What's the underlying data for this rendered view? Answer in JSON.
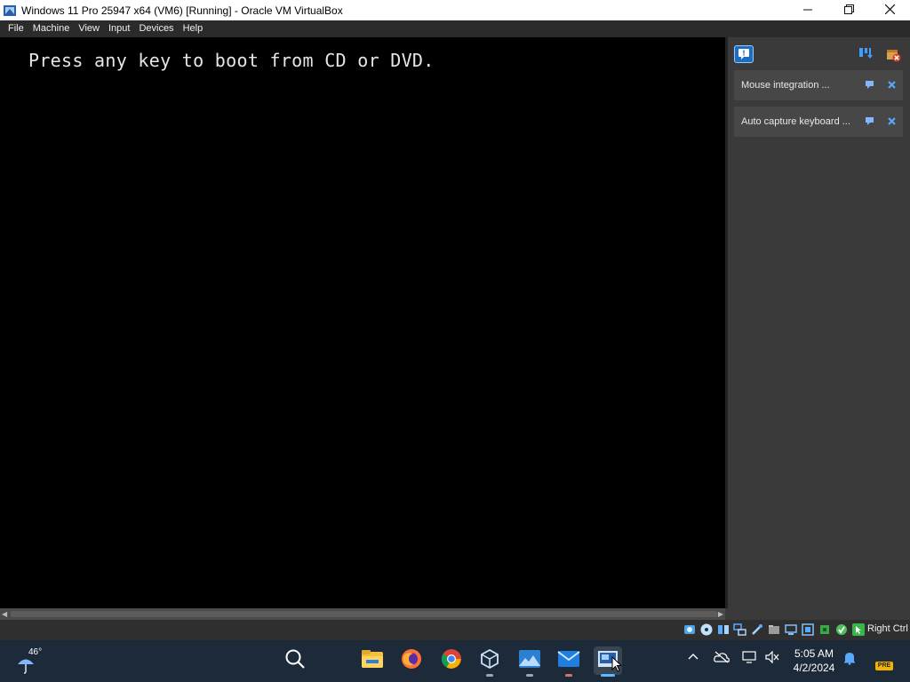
{
  "window": {
    "title": "Windows 11 Pro 25947 x64 (VM6) [Running] - Oracle VM VirtualBox",
    "minimize_icon": "minimize-icon",
    "maximize_icon": "restore-icon",
    "close_icon": "close-icon"
  },
  "menu": {
    "items": [
      "File",
      "Machine",
      "View",
      "Input",
      "Devices",
      "Help"
    ]
  },
  "vm": {
    "boot_message": "Press any key to boot from CD or DVD."
  },
  "notifications": {
    "items": [
      {
        "label": "Mouse integration ...",
        "pin_icon": "pin-icon",
        "close_icon": "close-icon"
      },
      {
        "label": "Auto capture keyboard ...",
        "pin_icon": "pin-icon",
        "close_icon": "close-icon"
      }
    ]
  },
  "statusbar": {
    "icons": [
      "hard-disk-icon",
      "optical-drive-icon",
      "audio-icon",
      "network-icon",
      "usb-icon",
      "shared-folders-icon",
      "display-icon",
      "recording-icon",
      "cpu-icon",
      "vt-x-icon",
      "mouse-integration-icon"
    ],
    "host_key": "Right Ctrl"
  },
  "taskbar": {
    "weather_temp": "46°",
    "apps": [
      "search-icon",
      "file-explorer-icon",
      "firefox-icon",
      "chrome-icon",
      "virtualbox-icon",
      "photos-icon",
      "mail-icon",
      "virtualbox-vm-icon"
    ],
    "time": "5:05 AM",
    "date": "4/2/2024",
    "pre_badge": "PRE"
  },
  "colors": {
    "menubar_bg": "#2b2b2b",
    "panel_bg": "#3a3a3a",
    "taskbar_bg": "#1d2a3a",
    "accent": "#5aa9ff"
  }
}
